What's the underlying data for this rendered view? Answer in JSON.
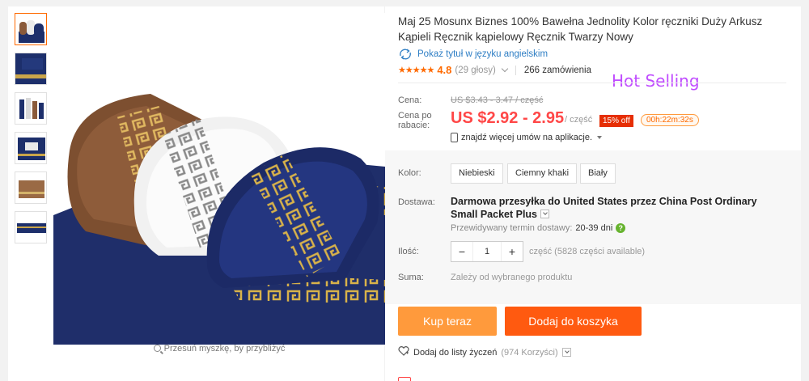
{
  "colors": {
    "accent": "#ff6a00",
    "price": "#ff4747",
    "link": "#2e7ec4",
    "hot": "#c04cff",
    "buy_now": "#ff9a3c",
    "add_cart": "#ff5a10"
  },
  "gallery": {
    "thumb_count": 6,
    "zoom_hint": "Przesuń myszkę, by przybliżyć"
  },
  "product": {
    "title": "Maj 25 Mosunx Biznes 100% Bawełna Jednolity Kolor ręczniki Duży Arkusz Kąpieli Ręcznik kąpielowy Ręcznik Twarzy Nowy",
    "translate_link": "Pokaż tytuł w języku angielskim",
    "stars": "★★★★★",
    "rating": "4.8",
    "votes": "(29 głosy)",
    "orders": "266 zamówienia",
    "overlay": "Hot Selling"
  },
  "price": {
    "label": "Cena:",
    "old": "US $3.43 - 3.47 / część",
    "discount_label": "Cena po rabacie:",
    "current": "US $2.92 - 2.95",
    "per": "/ część",
    "off": "15% off",
    "timer": "00h:22m:32s",
    "app_deals": "znajdź więcej umów na aplikacje."
  },
  "options": {
    "color_label": "Kolor:",
    "colors": [
      "Niebieski",
      "Ciemny khaki",
      "Biały"
    ],
    "delivery_label": "Dostawa:",
    "shipping": "Darmowa przesyłka do United States przez China Post Ordinary Small Packet Plus",
    "eta_label": "Przewidywany termin dostawy:",
    "eta_days": "20-39 dni",
    "qty_label": "Ilość:",
    "qty_value": "1",
    "qty_minus": "−",
    "qty_plus": "+",
    "availability": "część (5828 części available)",
    "sum_label": "Suma:",
    "sum_value": "Zależy od wybranego produktu"
  },
  "actions": {
    "buy_now": "Kup teraz",
    "add_to_cart": "Dodaj do koszyka",
    "wishlist": "Dodaj do listy życzeń",
    "wishlist_count": "(974 Korzyści)"
  }
}
